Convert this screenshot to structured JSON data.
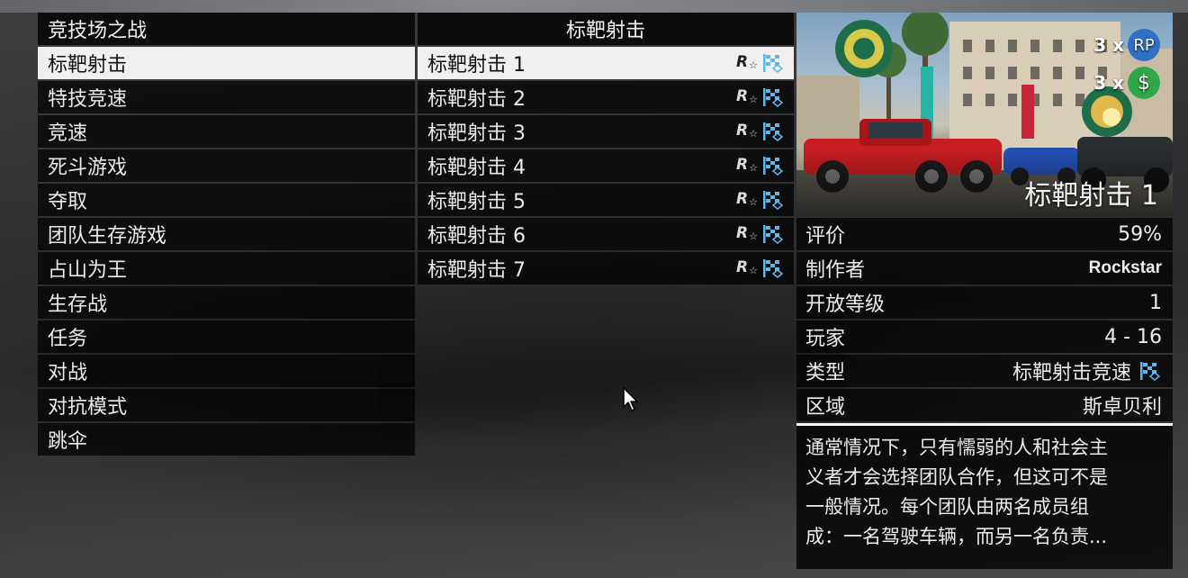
{
  "categories": {
    "header": "竞技场之战",
    "items": [
      "标靶射击",
      "特技竞速",
      "竞速",
      "死斗游戏",
      "夺取",
      "团队生存游戏",
      "占山为王",
      "生存战",
      "任务",
      "对战",
      "对抗模式",
      "跳伞"
    ],
    "selected_index": 0
  },
  "jobs": {
    "header": "标靶射击",
    "items": [
      "标靶射击 1",
      "标靶射击 2",
      "标靶射击 3",
      "标靶射击 4",
      "标靶射击 5",
      "标靶射击 6",
      "标靶射击 7"
    ],
    "selected_index": 0,
    "icons": [
      "rockstar-verified-icon",
      "checkered-flag-icon"
    ]
  },
  "details": {
    "title": "标靶射击 1",
    "multipliers": [
      {
        "label": "3 x",
        "badge": "RP",
        "color": "#2f6fc4"
      },
      {
        "label": "3 x",
        "badge": "$",
        "color": "#2fa74a"
      }
    ],
    "rows": [
      {
        "key": "评价",
        "value": "59%"
      },
      {
        "key": "制作者",
        "value": "Rockstar"
      },
      {
        "key": "开放等级",
        "value": "1"
      },
      {
        "key": "玩家",
        "value": "4 - 16"
      },
      {
        "key": "类型",
        "value": "标靶射击竞速"
      },
      {
        "key": "区域",
        "value": "斯卓贝利"
      }
    ],
    "description": [
      "通常情况下，只有懦弱的人和社会主",
      "义者才会选择团队合作，但这可不是",
      "一般情况。每个团队由两名成员组",
      "成：一名驾驶车辆，而另一名负责..."
    ]
  },
  "colors": {
    "flag": "#5db7ea",
    "selected_bg": "#f0f0f0"
  }
}
